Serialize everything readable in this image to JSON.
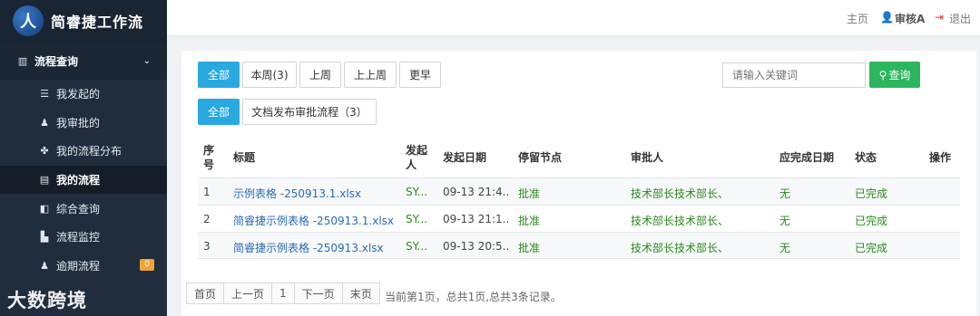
{
  "brand": {
    "logo": "人",
    "title": "简睿捷工作流"
  },
  "sidebar": {
    "group": {
      "label": "流程查询",
      "icon": "bar-chart-icon"
    },
    "items": [
      {
        "label": "我发起的",
        "icon": "list-icon"
      },
      {
        "label": "我审批的",
        "icon": "user-edit-icon"
      },
      {
        "label": "我的流程分布",
        "icon": "grid-icon"
      },
      {
        "label": "我的流程",
        "icon": "server-icon",
        "active": true
      },
      {
        "label": "综合查询",
        "icon": "toggle-icon"
      },
      {
        "label": "流程监控",
        "icon": "monitor-icon"
      },
      {
        "label": "逾期流程",
        "icon": "user-clock-icon",
        "badge": "0"
      }
    ]
  },
  "watermark": "大数跨境",
  "topbar": {
    "home": "主页",
    "user": "审核A",
    "logout": "退出"
  },
  "filters": {
    "time": [
      "全部",
      "本周(3)",
      "上周",
      "上上周",
      "更早"
    ],
    "type": [
      "全部",
      "文档发布审批流程（3）"
    ]
  },
  "search": {
    "placeholder": "请输入关键词",
    "button": "查询"
  },
  "table": {
    "headers": {
      "index": "序号",
      "title": "标题",
      "initiator": "发起人",
      "date": "发起日期",
      "node": "停留节点",
      "approver": "审批人",
      "due": "应完成日期",
      "status": "状态",
      "action": "操作"
    },
    "rows": [
      {
        "index": "1",
        "title": "示例表格 -250913.1.xlsx",
        "initiator": "SY...",
        "date": "09-13 21:4...",
        "node": "批准",
        "approver": "技术部长技术部长、",
        "due": "无",
        "status": "已完成"
      },
      {
        "index": "2",
        "title": "简睿捷示例表格 -250913.1.xlsx",
        "initiator": "SY...",
        "date": "09-13 21:1...",
        "node": "批准",
        "approver": "技术部长技术部长、",
        "due": "无",
        "status": "已完成"
      },
      {
        "index": "3",
        "title": "简睿捷示例表格 -250913.xlsx",
        "initiator": "SY...",
        "date": "09-13 20:5...",
        "node": "批准",
        "approver": "技术部长技术部长、",
        "due": "无",
        "status": "已完成"
      }
    ]
  },
  "pager": {
    "first": "首页",
    "prev": "上一页",
    "current": "1",
    "next": "下一页",
    "last": "末页",
    "info": "当前第1页，总共1页,总共3条记录。"
  },
  "colors": {
    "sidebar": "#1f2d3d",
    "primary": "#2aa9e0",
    "search": "#2db55d",
    "link": "#2a6bb6",
    "success": "#2b8a1c",
    "badge": "#f0a33a"
  }
}
